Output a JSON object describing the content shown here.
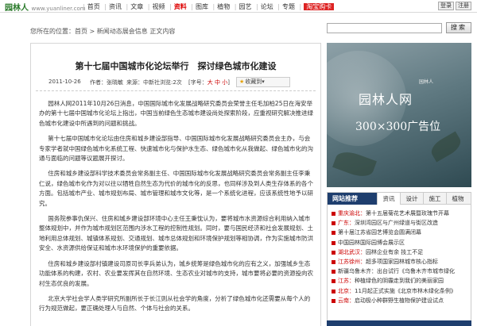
{
  "site": {
    "logo": "园林人",
    "logo_sub": "www.yuanliner.com"
  },
  "nav": {
    "items": [
      "首页",
      "资讯",
      "文章",
      "视频",
      "资料",
      "图库",
      "植物",
      "园艺",
      "论坛",
      "专题"
    ],
    "highlight": "资料",
    "shop": "淘宝购卡",
    "login": "登录",
    "register": "注册"
  },
  "breadcrumb": "您所在的位置：首页 > 新闻动态展会信息 正文内容",
  "search": {
    "button": "搜索",
    "placeholder": ""
  },
  "article": {
    "title": "第十七届中国城市化论坛举行　探讨绿色城市化建设",
    "date": "2011-10-26",
    "author": "作者：张晓敏",
    "source": "来源：中新社",
    "views": "浏览:2次",
    "font_label": "[字号：",
    "font_sizes": [
      "大",
      "中",
      "小"
    ],
    "font_close": "]",
    "favorite": "收藏到",
    "paragraphs": [
      "园林人网2011年10月26日消息，中国国际城市化发展战略研究委员会荣誉主任毛加柏25日在海安举办的第十七届中国城市化论坛上指出，中国当前绿色生态城市建设尚处探索阶段，应重视研究解决推进绿色城市化建设中所遇到的问题和挑战。",
      "第十七届中国城市化论坛由住房和城乡建设部指导、中国国际城市化发展战略研究委员会主办，与会专家学者就中国绿色城市化系统工程、快速城市化与保护水生态、绿色城市化从我做起、绿色城市化的沟通与面临的问题等议题展开探讨。",
      "住房和城乡建设部科学技术委员会常务副主任、中国国际城市化发展战略研究委员会常务副主任李秉仁说，绿色城市化作为对以往以牺牲自然生态为代价的城市化的反思，也同样涉及到人类生存体系的各个方面。包括城市产业、城市规划布局、城市管理和城市文化等，是一个系统化进程，应该系统性地予以研究。",
      "国务院参事仇保兴、住房和城乡建设部环境中心主任王秉忱认为，要将城市水资源综合利用纳入城市整体规划中，并作为城市规划区范围内涉水工程的控制性规划。同时，要与国民经济和社会发展规划、土地利用总体规划、城镇体系规划、交通规划、城市总体规划和环境保护规划等相协调，作为实施城市防洪安全、水资源供给保证和城市水环境保护的重要依据。",
      "住房和城乡建设部村镇建设司原司长李兵弟认为，城乡统筹是绿色城市化的应有之义，加强城乡生态功能体系的构建，农村、农业要发挥其在自然环境、生态农业对城市的支持，城市要将必要的资源投向农村生态优良的发展。",
      "北京大学社会学人类学研究所副所长于长江则从社会学的角度，分析了绿色城市化还需要从每个人的行为规范做起，要正确处理人与自然、个体与社会的关系。"
    ]
  },
  "ad": {
    "title": "园林人网",
    "subtitle": "300×300广告位",
    "brand": "园林人"
  },
  "recommend": {
    "head": "网站推荐",
    "tabs": [
      "资讯",
      "设计",
      "施工",
      "植物"
    ],
    "items": [
      {
        "region": "重庆渝北：",
        "text": "第十五届菊花艺术展暨玫瑰节开幕"
      },
      {
        "region": "广东：",
        "text": "深圳湾园区与广州绿道与街区改造"
      },
      {
        "region": "",
        "text": "第十届江苏省园艺博览会圆满闭幕"
      },
      {
        "region": "",
        "text": "中国园林国际园博会展示区"
      },
      {
        "region": "湖北武汉：",
        "text": "园林企业有余 技工不足"
      },
      {
        "region": "江苏徐州：",
        "text": "超多项国家园林城市核心指标"
      },
      {
        "region": "",
        "text": "新疆乌鲁木齐：出台试行《乌鲁木齐市城市绿化"
      },
      {
        "region": "江苏：",
        "text": "种植绿色的阴霾走到我们的美丽家园"
      },
      {
        "region": "北京：",
        "text": "11月起正式实施《北京市林木绿化条例》"
      },
      {
        "region": "云南：",
        "text": "启动极小种群野生植物保护建设试点"
      }
    ]
  },
  "colors": {
    "accent": "#1e3e6e",
    "highlight": "#cc0000",
    "green": "#2a7a2a"
  }
}
